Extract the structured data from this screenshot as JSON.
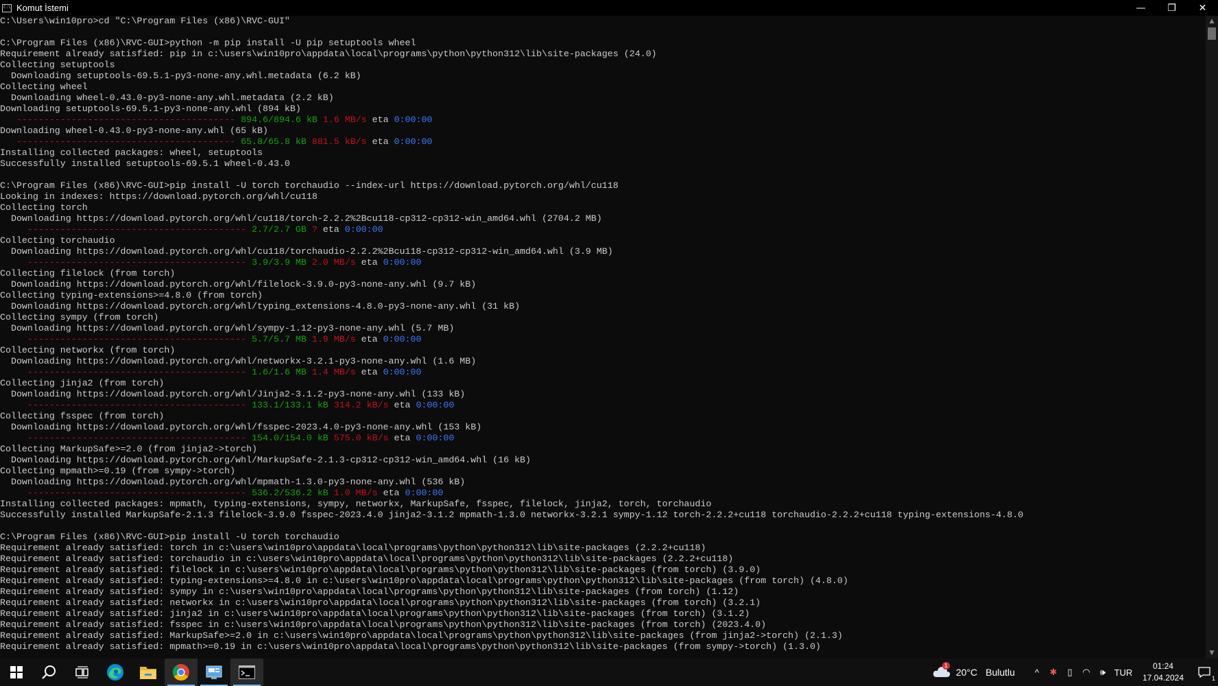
{
  "window": {
    "title": "Komut İstemi",
    "icon_text": "C:\\",
    "buttons": {
      "minimize": "—",
      "maximize": "❐",
      "close": "✕"
    }
  },
  "console_lines": [
    [
      {
        "t": "C:\\Users\\win10pro>cd \"C:\\Program Files (x86)\\RVC-GUI\""
      }
    ],
    [
      {
        "t": ""
      }
    ],
    [
      {
        "t": "C:\\Program Files (x86)\\RVC-GUI>python -m pip install -U pip setuptools wheel"
      }
    ],
    [
      {
        "t": "Requirement already satisfied: pip in c:\\users\\win10pro\\appdata\\local\\programs\\python\\python312\\lib\\site-packages (24.0)"
      }
    ],
    [
      {
        "t": "Collecting setuptools"
      }
    ],
    [
      {
        "t": "  Downloading setuptools-69.5.1-py3-none-any.whl.metadata (6.2 kB)"
      }
    ],
    [
      {
        "t": "Collecting wheel"
      }
    ],
    [
      {
        "t": "  Downloading wheel-0.43.0-py3-none-any.whl.metadata (2.2 kB)"
      }
    ],
    [
      {
        "t": "Downloading setuptools-69.5.1-py3-none-any.whl (894 kB)"
      }
    ],
    [
      {
        "t": "   ---------------------------------------- ",
        "c": "dash"
      },
      {
        "t": "894.6/894.6 kB ",
        "c": "green"
      },
      {
        "t": "1.6 MB/s",
        "c": "red"
      },
      {
        "t": " eta "
      },
      {
        "t": "0:00:00",
        "c": "blue"
      }
    ],
    [
      {
        "t": "Downloading wheel-0.43.0-py3-none-any.whl (65 kB)"
      }
    ],
    [
      {
        "t": "   ---------------------------------------- ",
        "c": "dash"
      },
      {
        "t": "65.8/65.8 kB ",
        "c": "green"
      },
      {
        "t": "881.5 kB/s",
        "c": "red"
      },
      {
        "t": " eta "
      },
      {
        "t": "0:00:00",
        "c": "blue"
      }
    ],
    [
      {
        "t": "Installing collected packages: wheel, setuptools"
      }
    ],
    [
      {
        "t": "Successfully installed setuptools-69.5.1 wheel-0.43.0"
      }
    ],
    [
      {
        "t": ""
      }
    ],
    [
      {
        "t": "C:\\Program Files (x86)\\RVC-GUI>pip install -U torch torchaudio --index-url https://download.pytorch.org/whl/cu118"
      }
    ],
    [
      {
        "t": "Looking in indexes: https://download.pytorch.org/whl/cu118"
      }
    ],
    [
      {
        "t": "Collecting torch"
      }
    ],
    [
      {
        "t": "  Downloading https://download.pytorch.org/whl/cu118/torch-2.2.2%2Bcu118-cp312-cp312-win_amd64.whl (2704.2 MB)"
      }
    ],
    [
      {
        "t": "     ---------------------------------------- ",
        "c": "dash"
      },
      {
        "t": "2.7/2.7 GB ",
        "c": "green"
      },
      {
        "t": "?",
        "c": "red"
      },
      {
        "t": " eta "
      },
      {
        "t": "0:00:00",
        "c": "blue"
      }
    ],
    [
      {
        "t": "Collecting torchaudio"
      }
    ],
    [
      {
        "t": "  Downloading https://download.pytorch.org/whl/cu118/torchaudio-2.2.2%2Bcu118-cp312-cp312-win_amd64.whl (3.9 MB)"
      }
    ],
    [
      {
        "t": "     ---------------------------------------- ",
        "c": "dash"
      },
      {
        "t": "3.9/3.9 MB ",
        "c": "green"
      },
      {
        "t": "2.0 MB/s",
        "c": "red"
      },
      {
        "t": " eta "
      },
      {
        "t": "0:00:00",
        "c": "blue"
      }
    ],
    [
      {
        "t": "Collecting filelock (from torch)"
      }
    ],
    [
      {
        "t": "  Downloading https://download.pytorch.org/whl/filelock-3.9.0-py3-none-any.whl (9.7 kB)"
      }
    ],
    [
      {
        "t": "Collecting typing-extensions>=4.8.0 (from torch)"
      }
    ],
    [
      {
        "t": "  Downloading https://download.pytorch.org/whl/typing_extensions-4.8.0-py3-none-any.whl (31 kB)"
      }
    ],
    [
      {
        "t": "Collecting sympy (from torch)"
      }
    ],
    [
      {
        "t": "  Downloading https://download.pytorch.org/whl/sympy-1.12-py3-none-any.whl (5.7 MB)"
      }
    ],
    [
      {
        "t": "     ---------------------------------------- ",
        "c": "dash"
      },
      {
        "t": "5.7/5.7 MB ",
        "c": "green"
      },
      {
        "t": "1.9 MB/s",
        "c": "red"
      },
      {
        "t": " eta "
      },
      {
        "t": "0:00:00",
        "c": "blue"
      }
    ],
    [
      {
        "t": "Collecting networkx (from torch)"
      }
    ],
    [
      {
        "t": "  Downloading https://download.pytorch.org/whl/networkx-3.2.1-py3-none-any.whl (1.6 MB)"
      }
    ],
    [
      {
        "t": "     ---------------------------------------- ",
        "c": "dash"
      },
      {
        "t": "1.6/1.6 MB ",
        "c": "green"
      },
      {
        "t": "1.4 MB/s",
        "c": "red"
      },
      {
        "t": " eta "
      },
      {
        "t": "0:00:00",
        "c": "blue"
      }
    ],
    [
      {
        "t": "Collecting jinja2 (from torch)"
      }
    ],
    [
      {
        "t": "  Downloading https://download.pytorch.org/whl/Jinja2-3.1.2-py3-none-any.whl (133 kB)"
      }
    ],
    [
      {
        "t": "     ---------------------------------------- ",
        "c": "dash"
      },
      {
        "t": "133.1/133.1 kB ",
        "c": "green"
      },
      {
        "t": "314.2 kB/s",
        "c": "red"
      },
      {
        "t": " eta "
      },
      {
        "t": "0:00:00",
        "c": "blue"
      }
    ],
    [
      {
        "t": "Collecting fsspec (from torch)"
      }
    ],
    [
      {
        "t": "  Downloading https://download.pytorch.org/whl/fsspec-2023.4.0-py3-none-any.whl (153 kB)"
      }
    ],
    [
      {
        "t": "     ---------------------------------------- ",
        "c": "dash"
      },
      {
        "t": "154.0/154.0 kB ",
        "c": "green"
      },
      {
        "t": "575.0 kB/s",
        "c": "red"
      },
      {
        "t": " eta "
      },
      {
        "t": "0:00:00",
        "c": "blue"
      }
    ],
    [
      {
        "t": "Collecting MarkupSafe>=2.0 (from jinja2->torch)"
      }
    ],
    [
      {
        "t": "  Downloading https://download.pytorch.org/whl/MarkupSafe-2.1.3-cp312-cp312-win_amd64.whl (16 kB)"
      }
    ],
    [
      {
        "t": "Collecting mpmath>=0.19 (from sympy->torch)"
      }
    ],
    [
      {
        "t": "  Downloading https://download.pytorch.org/whl/mpmath-1.3.0-py3-none-any.whl (536 kB)"
      }
    ],
    [
      {
        "t": "     ---------------------------------------- ",
        "c": "dash"
      },
      {
        "t": "536.2/536.2 kB ",
        "c": "green"
      },
      {
        "t": "1.0 MB/s",
        "c": "red"
      },
      {
        "t": " eta "
      },
      {
        "t": "0:00:00",
        "c": "blue"
      }
    ],
    [
      {
        "t": "Installing collected packages: mpmath, typing-extensions, sympy, networkx, MarkupSafe, fsspec, filelock, jinja2, torch, torchaudio"
      }
    ],
    [
      {
        "t": "Successfully installed MarkupSafe-2.1.3 filelock-3.9.0 fsspec-2023.4.0 jinja2-3.1.2 mpmath-1.3.0 networkx-3.2.1 sympy-1.12 torch-2.2.2+cu118 torchaudio-2.2.2+cu118 typing-extensions-4.8.0"
      }
    ],
    [
      {
        "t": ""
      }
    ],
    [
      {
        "t": "C:\\Program Files (x86)\\RVC-GUI>pip install -U torch torchaudio"
      }
    ],
    [
      {
        "t": "Requirement already satisfied: torch in c:\\users\\win10pro\\appdata\\local\\programs\\python\\python312\\lib\\site-packages (2.2.2+cu118)"
      }
    ],
    [
      {
        "t": "Requirement already satisfied: torchaudio in c:\\users\\win10pro\\appdata\\local\\programs\\python\\python312\\lib\\site-packages (2.2.2+cu118)"
      }
    ],
    [
      {
        "t": "Requirement already satisfied: filelock in c:\\users\\win10pro\\appdata\\local\\programs\\python\\python312\\lib\\site-packages (from torch) (3.9.0)"
      }
    ],
    [
      {
        "t": "Requirement already satisfied: typing-extensions>=4.8.0 in c:\\users\\win10pro\\appdata\\local\\programs\\python\\python312\\lib\\site-packages (from torch) (4.8.0)"
      }
    ],
    [
      {
        "t": "Requirement already satisfied: sympy in c:\\users\\win10pro\\appdata\\local\\programs\\python\\python312\\lib\\site-packages (from torch) (1.12)"
      }
    ],
    [
      {
        "t": "Requirement already satisfied: networkx in c:\\users\\win10pro\\appdata\\local\\programs\\python\\python312\\lib\\site-packages (from torch) (3.2.1)"
      }
    ],
    [
      {
        "t": "Requirement already satisfied: jinja2 in c:\\users\\win10pro\\appdata\\local\\programs\\python\\python312\\lib\\site-packages (from torch) (3.1.2)"
      }
    ],
    [
      {
        "t": "Requirement already satisfied: fsspec in c:\\users\\win10pro\\appdata\\local\\programs\\python\\python312\\lib\\site-packages (from torch) (2023.4.0)"
      }
    ],
    [
      {
        "t": "Requirement already satisfied: MarkupSafe>=2.0 in c:\\users\\win10pro\\appdata\\local\\programs\\python\\python312\\lib\\site-packages (from jinja2->torch) (2.1.3)"
      }
    ],
    [
      {
        "t": "Requirement already satisfied: mpmath>=0.19 in c:\\users\\win10pro\\appdata\\local\\programs\\python\\python312\\lib\\site-packages (from sympy->torch) (1.3.0)"
      }
    ]
  ],
  "taskbar": {
    "icons": [
      "windows-start-icon",
      "search-icon",
      "task-view-icon",
      "edge-icon",
      "file-explorer-icon",
      "chrome-icon",
      "control-panel-icon",
      "command-prompt-icon"
    ],
    "weather": {
      "temp": "20°C",
      "condition": "Bulutlu",
      "badge": "1"
    },
    "language": "TUR",
    "time": "01:24",
    "date": "17.04.2024",
    "notification_count": "1"
  },
  "colors": {
    "green": "#13a10e",
    "red": "#c50f1f",
    "blue": "#3b78ff",
    "text": "#cccccc",
    "bg": "#0c0c0c"
  }
}
